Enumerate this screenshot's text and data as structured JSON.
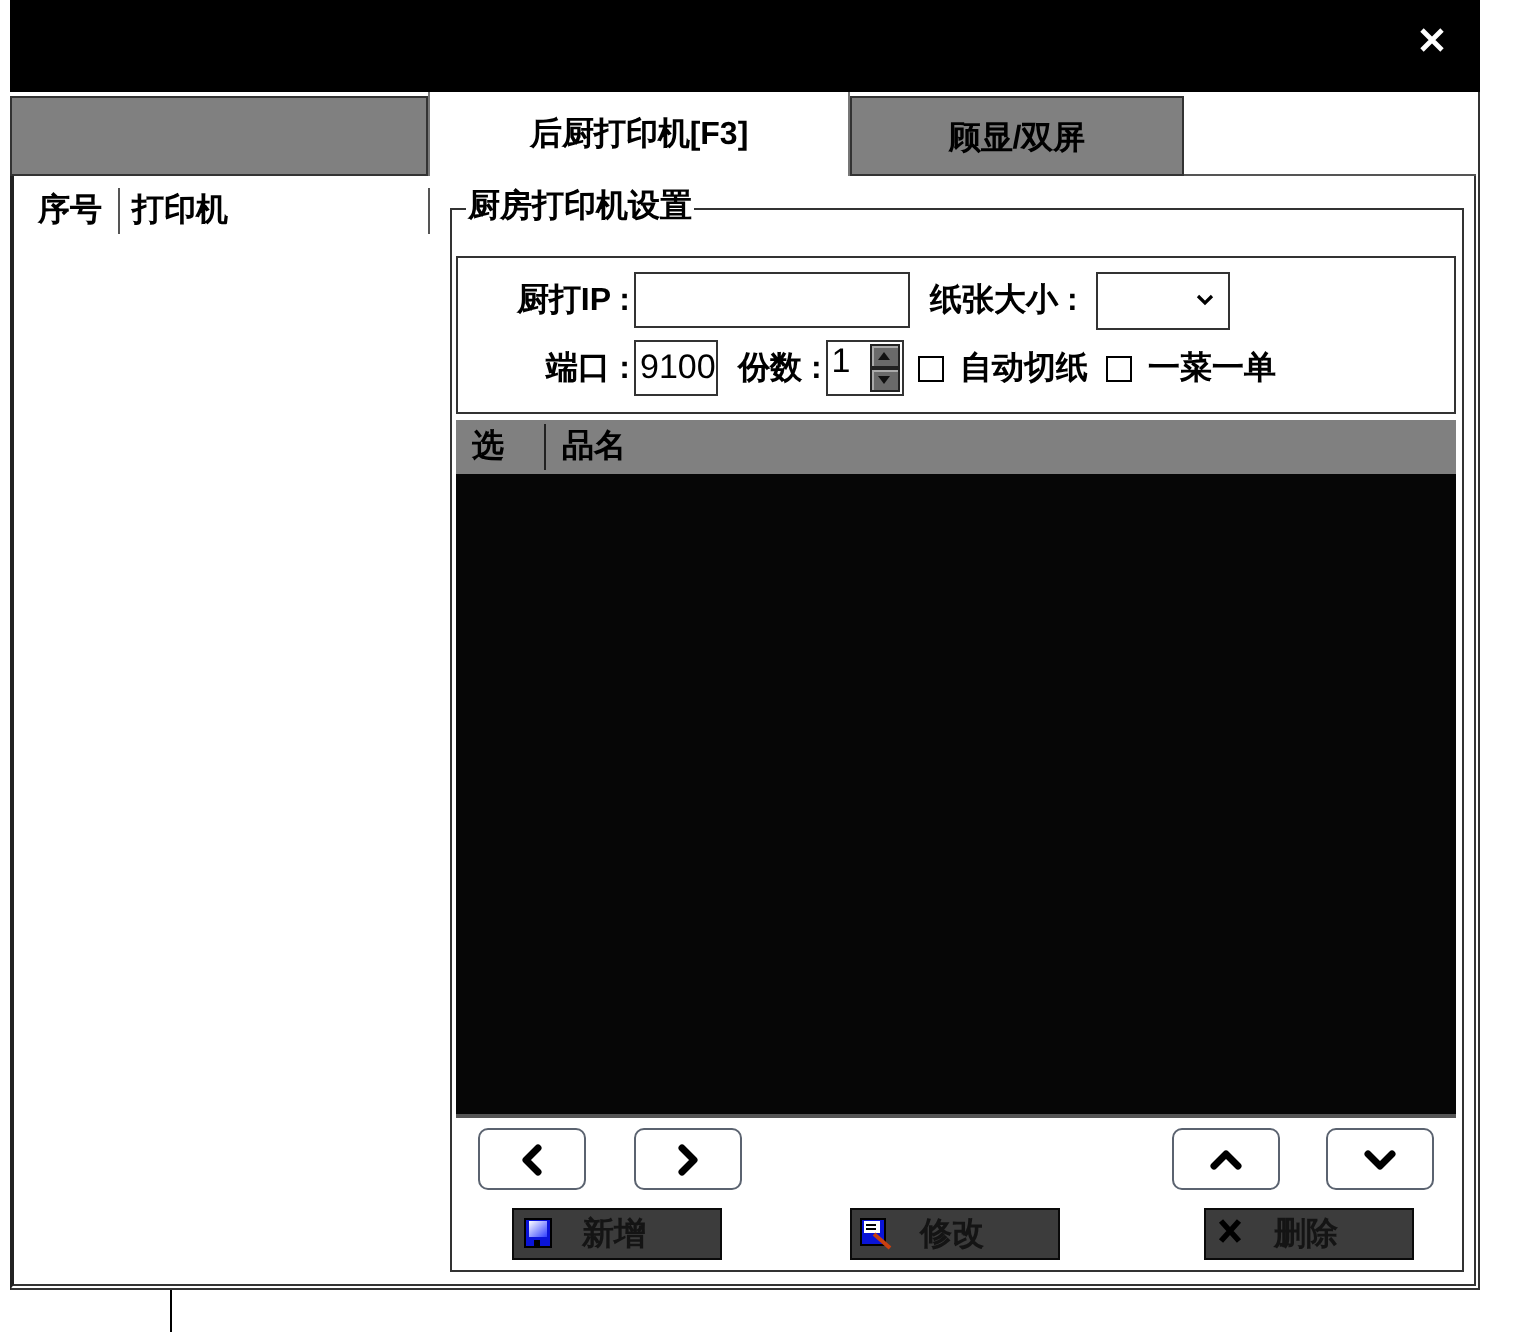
{
  "tabs": [
    {
      "selected": false
    },
    {
      "label": "后厨打印机[F3]",
      "selected": true
    },
    {
      "label": "顾显/双屏",
      "selected": false
    }
  ],
  "printer_list": {
    "columns": [
      "序号",
      "打印机"
    ]
  },
  "kitchen_printer_settings": {
    "title": "厨房打印机设置",
    "rows": [
      {
        "fields": [
          {
            "kind": "text",
            "label": "厨打IP :"
          },
          {
            "kind": "select",
            "label": "纸张大小 :"
          }
        ]
      },
      {
        "fields": [
          {
            "kind": "text",
            "label": "端口 :",
            "value": "9100"
          },
          {
            "kind": "spinner",
            "label": "份数 :",
            "value": "1"
          },
          {
            "kind": "checkbox",
            "label": "自动切纸",
            "checked": false
          },
          {
            "kind": "checkbox",
            "label": "一菜一单",
            "checked": false
          }
        ]
      }
    ],
    "dish_table": {
      "columns": [
        "选",
        "品名"
      ]
    },
    "buttons": [
      {
        "kind": "add",
        "label": "新增"
      },
      {
        "kind": "edit",
        "label": "修改"
      },
      {
        "kind": "delete",
        "label": "删除"
      }
    ]
  }
}
